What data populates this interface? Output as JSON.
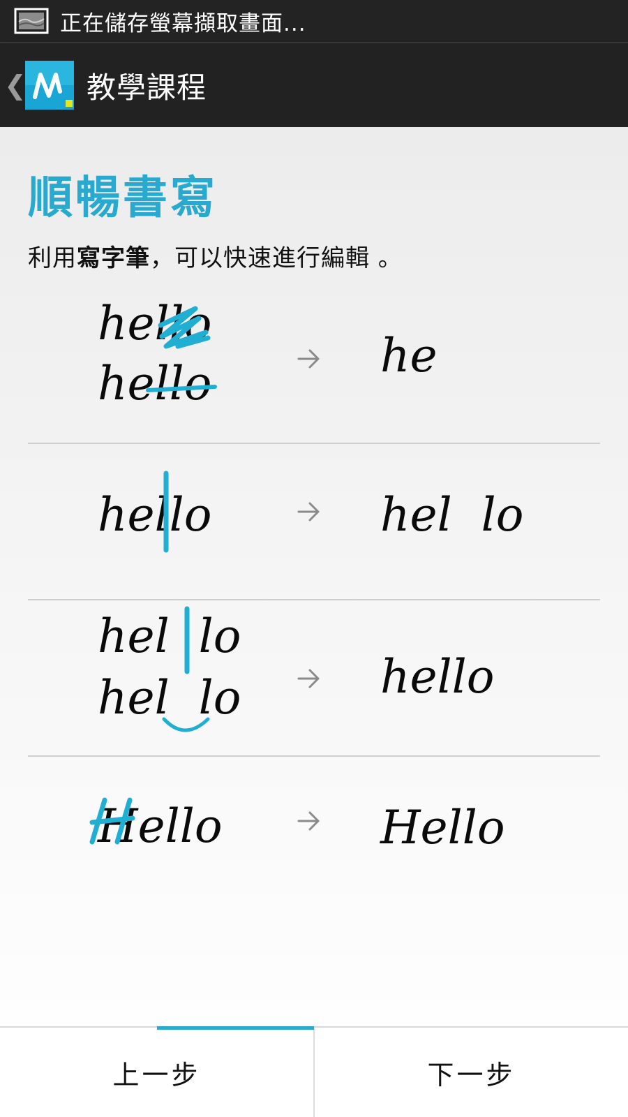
{
  "status_bar": {
    "text": "正在儲存螢幕擷取畫面..."
  },
  "action_bar": {
    "title": "教學課程"
  },
  "content": {
    "title": "順暢書寫",
    "intro_prefix": "利用",
    "intro_bold": "寫字筆",
    "intro_suffix": "，可以快速進行編輯 。"
  },
  "examples": [
    {
      "before": [
        "hello",
        "hello"
      ],
      "gesture": "scribble-delete / strike-through",
      "after": "he"
    },
    {
      "before": [
        "hello"
      ],
      "gesture": "vertical split",
      "after": "hel  lo"
    },
    {
      "before": [
        "hel  lo",
        "hel  lo"
      ],
      "gesture": "join",
      "after": "hello"
    },
    {
      "before": [
        "Hello"
      ],
      "gesture": "overwrite",
      "after": "Hello"
    }
  ],
  "bottom_bar": {
    "prev_label": "上一步",
    "next_label": "下一步"
  },
  "colors": {
    "accent": "#27a9d0",
    "bar_dark": "#222222"
  }
}
